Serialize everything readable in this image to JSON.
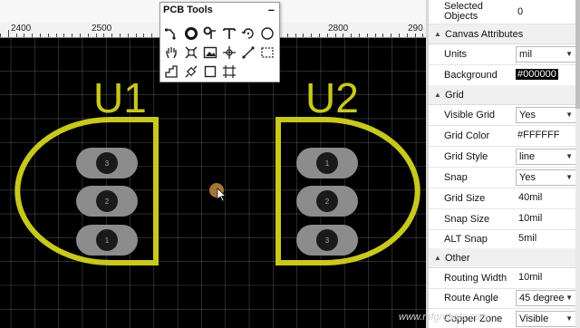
{
  "ruler": {
    "labels": [
      "2400",
      "2500",
      "2800",
      "290"
    ]
  },
  "board": {
    "components": [
      {
        "designator": "U1",
        "pads": [
          "3",
          "2",
          "1"
        ]
      },
      {
        "designator": "U2",
        "pads": [
          "1",
          "2",
          "3"
        ]
      }
    ],
    "silk_color": "#C8C81E",
    "grid_color": "#FFFFFF",
    "background": "#000000"
  },
  "pcb_tools": {
    "title": "PCB Tools",
    "minimize": "–",
    "tools": [
      "route-icon",
      "via-icon",
      "probe-icon",
      "text-icon",
      "arc-icon",
      "circle-icon",
      "pan-icon",
      "select-icon",
      "image-icon",
      "measure-icon",
      "line-icon",
      "region-icon",
      "polygon-icon",
      "component-icon",
      "rectangle-icon",
      "grid-icon"
    ]
  },
  "properties": {
    "selected_objects": {
      "label": "Selected Objects",
      "value": "0"
    },
    "sections": {
      "canvas": "Canvas Attributes",
      "grid": "Grid",
      "other": "Other"
    },
    "rows": {
      "units": {
        "label": "Units",
        "value": "mil"
      },
      "background": {
        "label": "Background",
        "value": "#000000"
      },
      "visible_grid": {
        "label": "Visible Grid",
        "value": "Yes"
      },
      "grid_color": {
        "label": "Grid Color",
        "value": "#FFFFFF"
      },
      "grid_style": {
        "label": "Grid Style",
        "value": "line"
      },
      "snap": {
        "label": "Snap",
        "value": "Yes"
      },
      "grid_size": {
        "label": "Grid Size",
        "value": "40mil"
      },
      "snap_size": {
        "label": "Snap Size",
        "value": "10mil"
      },
      "alt_snap": {
        "label": "ALT Snap",
        "value": "5mil"
      },
      "routing_width": {
        "label": "Routing Width",
        "value": "10mil"
      },
      "route_angle": {
        "label": "Route Angle",
        "value": "45 degree"
      },
      "copper_zone": {
        "label": "Copper Zone",
        "value": "Visible"
      }
    }
  },
  "watermark": "www.mfgrobots.com"
}
